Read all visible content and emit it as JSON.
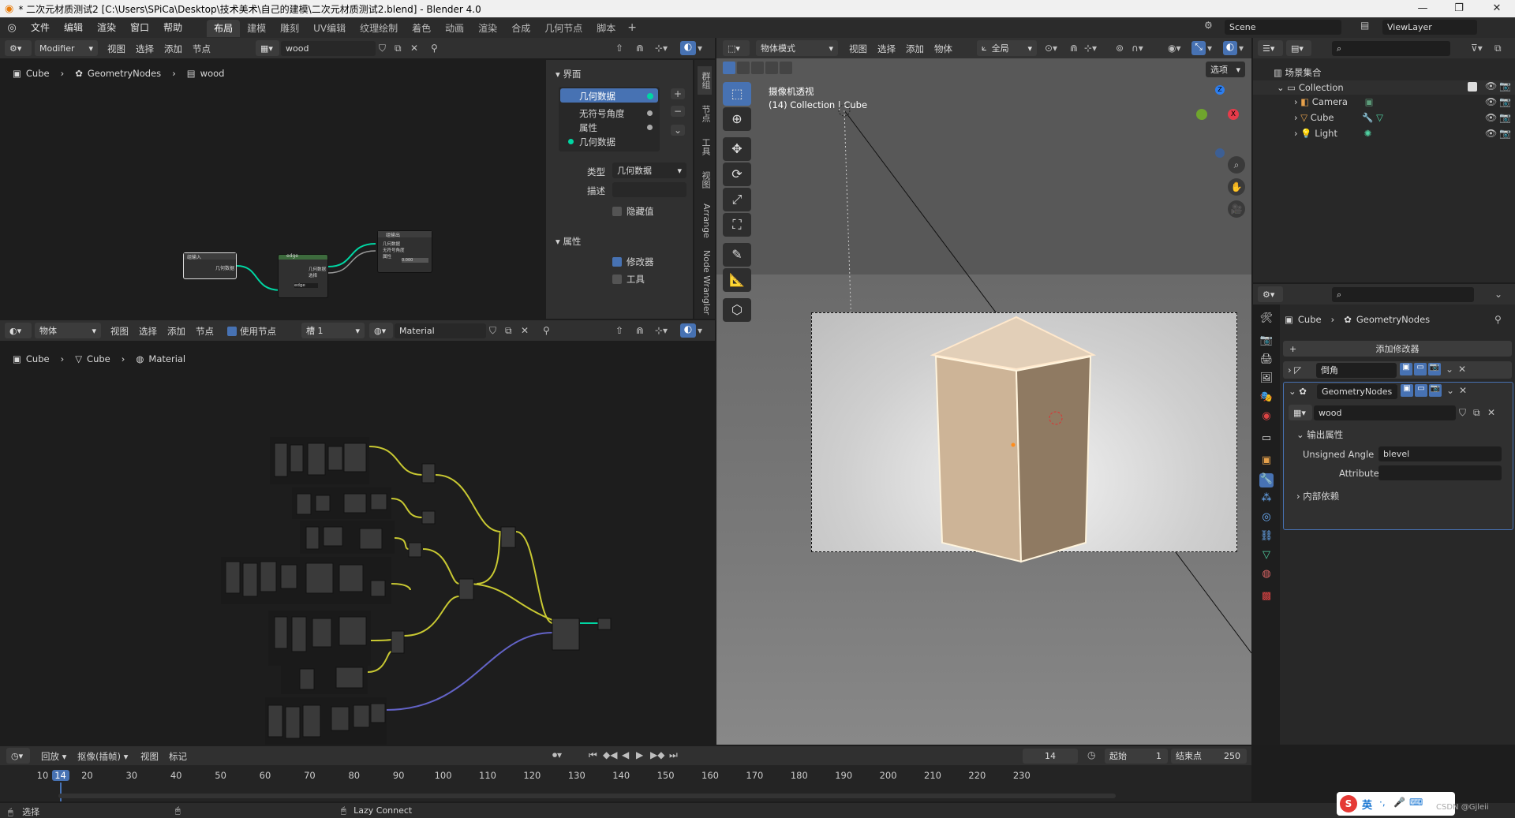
{
  "window": {
    "title": "* 二次元材质测试2 [C:\\Users\\SPiCa\\Desktop\\技术美术\\自己的建模\\二次元材质测试2.blend] - Blender 4.0",
    "minimize": "—",
    "maximize": "❐",
    "close": "✕"
  },
  "menu": [
    "文件",
    "编辑",
    "渲染",
    "窗口",
    "帮助"
  ],
  "workspaces": [
    "布局",
    "建模",
    "雕刻",
    "UV编辑",
    "纹理绘制",
    "着色",
    "动画",
    "渲染",
    "合成",
    "几何节点",
    "脚本"
  ],
  "workspace_add": "+",
  "scene": {
    "name": "Scene",
    "viewlayer": "ViewLayer"
  },
  "geo_editor": {
    "mode": "Modifier",
    "menus": [
      "视图",
      "选择",
      "添加",
      "节点"
    ],
    "tree_name": "wood",
    "breadcrumb": [
      "Cube",
      "GeometryNodes",
      "wood"
    ],
    "panel_interface": "界面",
    "sockets": [
      "几何数据",
      "无符号角度",
      "属性",
      "几何数据"
    ],
    "type_label": "类型",
    "type_value": "几何数据",
    "desc_label": "描述",
    "hide_value": "隐藏值",
    "panel_attr": "属性",
    "modifier_cb": "修改器",
    "tool_cb": "工具",
    "tabs": [
      "群组",
      "节点",
      "工具",
      "视图",
      "Arrange",
      "Node Wrangler"
    ],
    "node_input": {
      "title": "组输入",
      "socket": "几何数据"
    },
    "node_edge": {
      "title": "edge",
      "out1": "几何数据",
      "out2": "选择",
      "field": "edge"
    },
    "node_output": {
      "title": "组输出",
      "s1": "几何数据",
      "s2": "无符号角度",
      "s3": "属性",
      "val": "0.000"
    }
  },
  "shader_editor": {
    "mode": "物体",
    "menus": [
      "视图",
      "选择",
      "添加",
      "节点"
    ],
    "use_nodes": "使用节点",
    "slot": "槽 1",
    "material": "Material",
    "breadcrumb": [
      "Cube",
      "Cube",
      "Material"
    ]
  },
  "viewport": {
    "mode": "物体模式",
    "menus": [
      "视图",
      "选择",
      "添加",
      "物体"
    ],
    "transform": "全局",
    "options": "选项",
    "view_name": "摄像机透视",
    "collection_label": "(14) Collection | Cube"
  },
  "outliner": {
    "title": "场景集合",
    "items": [
      {
        "name": "Collection",
        "level": 1
      },
      {
        "name": "Camera",
        "level": 2
      },
      {
        "name": "Cube",
        "level": 2
      },
      {
        "name": "Light",
        "level": 2
      }
    ]
  },
  "properties": {
    "breadcrumb": [
      "Cube",
      "GeometryNodes"
    ],
    "add_modifier": "添加修改器",
    "mod1": "倒角",
    "mod2": "GeometryNodes",
    "tree": "wood",
    "output_attrs": "输出属性",
    "unsigned_angle_label": "Unsigned Angle",
    "unsigned_angle_value": "blevel",
    "attribute_label": "Attribute",
    "attribute_value": "",
    "internal_deps": "内部依赖"
  },
  "timeline": {
    "menus": [
      "回放",
      "抠像(插帧)",
      "视图",
      "标记"
    ],
    "current_frame": "14",
    "start_label": "起始",
    "start": "1",
    "end_label": "结束点",
    "end": "250",
    "ticks": [
      "10",
      "14",
      "20",
      "30",
      "40",
      "50",
      "60",
      "70",
      "80",
      "90",
      "100",
      "110",
      "120",
      "130",
      "140",
      "150",
      "160",
      "170",
      "180",
      "190",
      "200",
      "210",
      "220",
      "230"
    ]
  },
  "status": {
    "left": "选择",
    "middle": "Lazy Connect",
    "ime": "英",
    "watermark": "CSDN @Gjleii"
  },
  "colors": {
    "accent": "#4772b3",
    "geo_socket": "#00d6a3",
    "wire_yellow": "#c8c832",
    "wire_purple": "#6363c7",
    "selection": "#ff8c1a"
  }
}
